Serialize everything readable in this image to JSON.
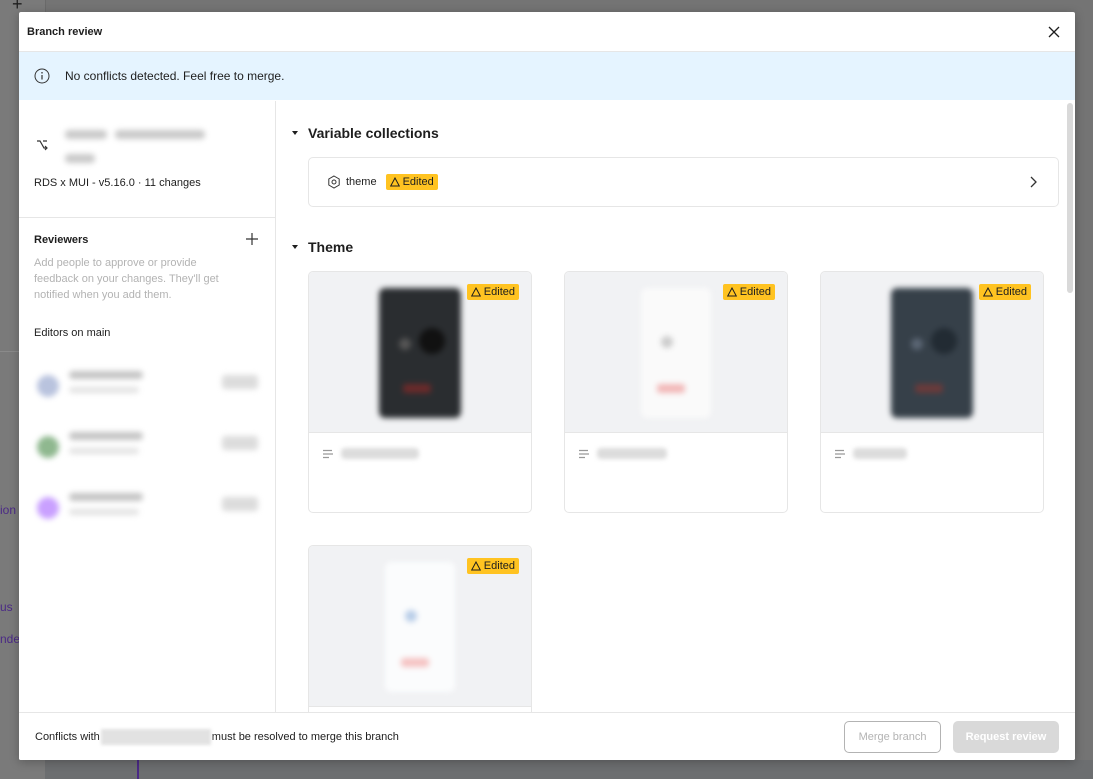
{
  "background": {
    "fragments": [
      "ion",
      "us",
      "nder"
    ],
    "accent": "#4b2a86"
  },
  "modal": {
    "title": "Branch review",
    "banner": {
      "icon": "info-icon",
      "text": "No conflicts detected. Feel free to merge.",
      "color": "#e5f4ff"
    },
    "sidebar": {
      "branch": {
        "icon": "branch-icon",
        "meta": "RDS x MUI - v5.16.0 · 11 changes"
      },
      "reviewers": {
        "title": "Reviewers",
        "description": "Add people to approve or provide feedback on your changes. They'll get notified when you add them."
      },
      "editors": {
        "title": "Editors on main",
        "avatar_colors": [
          "#b9c3de",
          "#8fb88f",
          "#c9a0ff"
        ]
      }
    },
    "main": {
      "sections": [
        {
          "title": "Variable collections",
          "items": [
            {
              "label": "theme",
              "icon": "variable-collection-icon",
              "badge": "Edited"
            }
          ]
        },
        {
          "title": "Theme",
          "cards": [
            {
              "badge": "Edited",
              "thumb_bg": "#2a2d30",
              "accent": "#6b2a2a"
            },
            {
              "badge": "Edited",
              "thumb_bg": "#fafafa",
              "accent": "#f2b8b8"
            },
            {
              "badge": "Edited",
              "thumb_bg": "#364049",
              "accent": "#6b3a3a"
            },
            {
              "badge": "Edited",
              "thumb_bg": "#f8f9fb",
              "accent": "#f5c2c2"
            }
          ]
        }
      ]
    },
    "footer": {
      "text_before": "Conflicts with",
      "text_after": "must be resolved to merge this branch",
      "merge_label": "Merge branch",
      "request_label": "Request review"
    },
    "badge_color": "#ffc321"
  }
}
